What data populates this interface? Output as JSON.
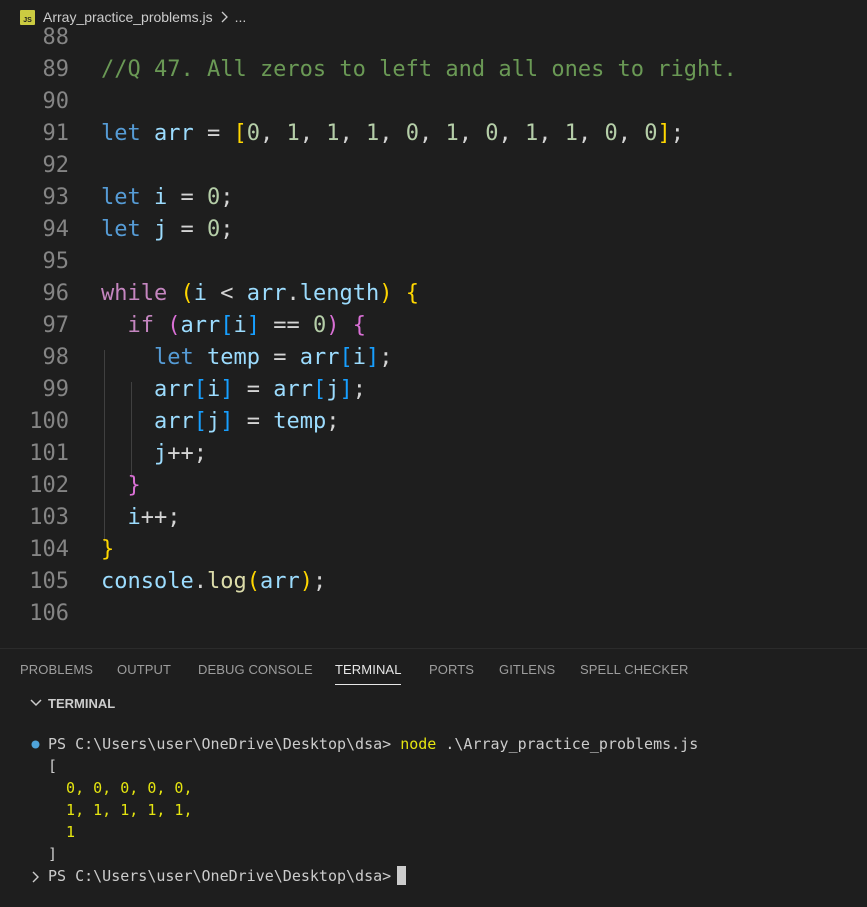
{
  "breadcrumb": {
    "file_icon_text": "JS",
    "file": "Array_practice_problems.js",
    "more": "..."
  },
  "editor": {
    "line_numbers": [
      "88",
      "89",
      "90",
      "91",
      "92",
      "93",
      "94",
      "95",
      "96",
      "97",
      "98",
      "99",
      "100",
      "101",
      "102",
      "103",
      "104",
      "105",
      "106"
    ],
    "comment": "//Q 47. All zeros to left and all ones to right."
  },
  "panel": {
    "tabs": [
      "PROBLEMS",
      "OUTPUT",
      "DEBUG CONSOLE",
      "TERMINAL",
      "PORTS",
      "GITLENS",
      "SPELL CHECKER"
    ],
    "active_tab": "TERMINAL"
  },
  "terminal": {
    "header": "TERMINAL",
    "prompt": "PS C:\\Users\\user\\OneDrive\\Desktop\\dsa>",
    "command_name": "node",
    "command_arg": ".\\Array_practice_problems.js",
    "output": [
      "[",
      "  0, 0, 0, 0, 0,",
      "  1, 1, 1, 1, 1,",
      "  1",
      "]"
    ]
  },
  "colors": {
    "background": "#1e1e1e",
    "keyword": "#569cd6",
    "comment": "#6a9955",
    "number": "#b5cea8"
  }
}
